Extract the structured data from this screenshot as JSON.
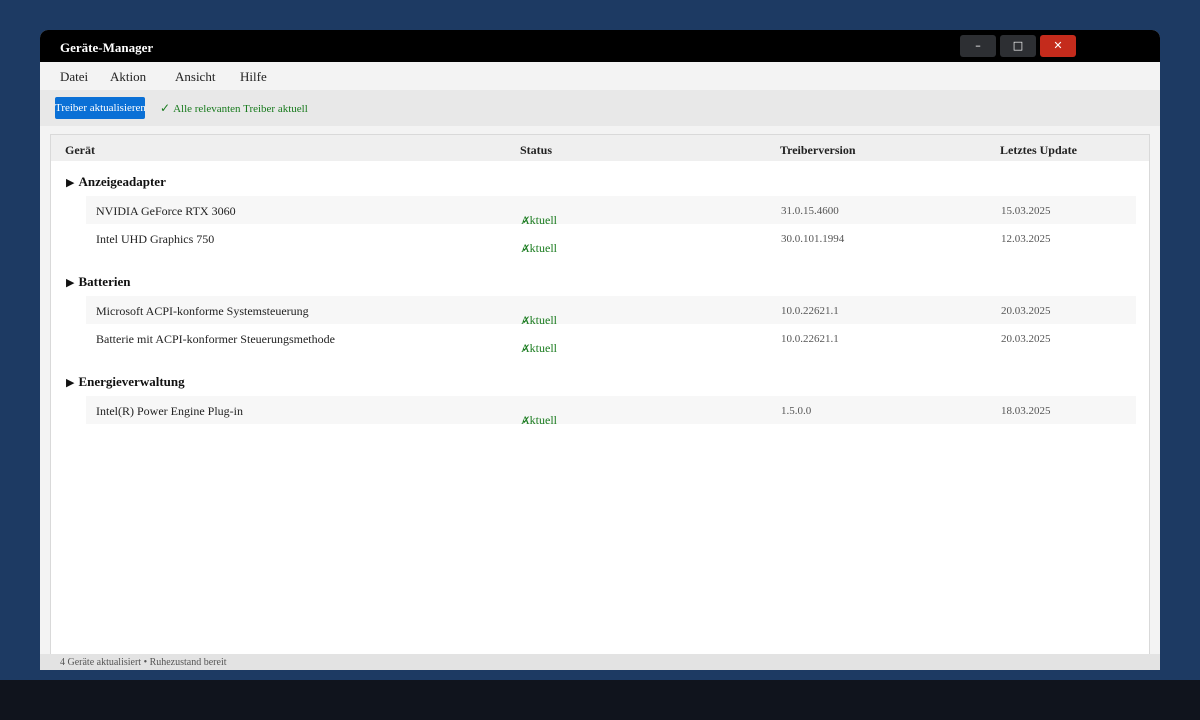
{
  "window": {
    "title": "Geräte-Manager",
    "controls": {
      "minimize": "–",
      "maximize": "□",
      "close": "✕"
    }
  },
  "menu": [
    "Datei",
    "Aktion",
    "Ansicht",
    "Hilfe"
  ],
  "toolbar": {
    "update_button": "Treiber aktualisieren",
    "status_icon": "✓",
    "status_text": "Alle relevanten Treiber aktuell"
  },
  "table": {
    "columns": [
      "Gerät",
      "Status",
      "Treiberversion",
      "Letztes Update"
    ],
    "groups": [
      {
        "name": "Anzeigeadapter",
        "devices": [
          {
            "name": "NVIDIA GeForce RTX 3060",
            "status": "Aktuell",
            "version": "31.0.15.4600",
            "date": "15.03.2025"
          },
          {
            "name": "Intel UHD Graphics 750",
            "status": "Aktuell",
            "version": "30.0.101.1994",
            "date": "12.03.2025"
          }
        ]
      },
      {
        "name": "Batterien",
        "devices": [
          {
            "name": "Microsoft ACPI-konforme Systemsteuerung",
            "status": "Aktuell",
            "version": "10.0.22621.1",
            "date": "20.03.2025"
          },
          {
            "name": "Batterie mit ACPI-konformer Steuerungsmethode",
            "status": "Aktuell",
            "version": "10.0.22621.1",
            "date": "20.03.2025"
          }
        ]
      },
      {
        "name": "Energieverwaltung",
        "devices": [
          {
            "name": "Intel(R) Power Engine Plug-in",
            "status": "Aktuell",
            "version": "1.5.0.0",
            "date": "18.03.2025"
          }
        ]
      }
    ]
  },
  "status_bar": "4 Geräte aktualisiert • Ruhezustand bereit",
  "colors": {
    "accent": "#0a70d6",
    "ok": "#197b1e",
    "close": "#c42b1c",
    "desktop": "#1d3a63"
  },
  "icons": {
    "check": "check-icon",
    "expand": "triangle-right-icon"
  }
}
